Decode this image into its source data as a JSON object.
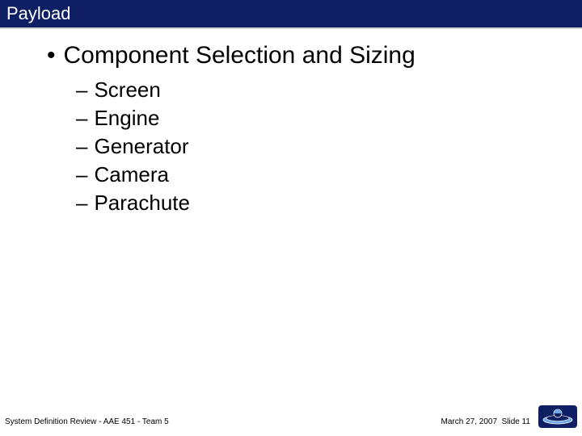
{
  "title": "Payload",
  "main_bullet": "Component Selection and Sizing",
  "sub_items": [
    "Screen",
    "Engine",
    "Generator",
    "Camera",
    "Parachute"
  ],
  "footer": {
    "left": "System Definition Review - AAE 451 - Team 5",
    "date": "March 27, 2007",
    "slide_label": "Slide 11"
  }
}
